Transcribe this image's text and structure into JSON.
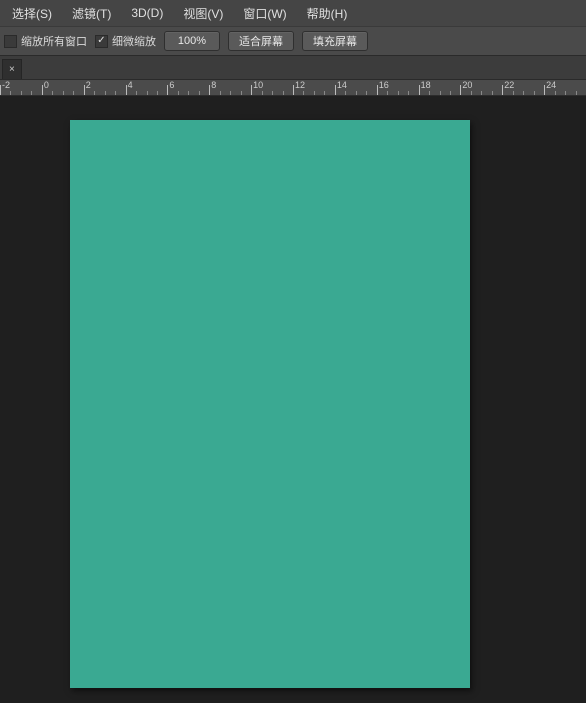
{
  "menubar": {
    "items": [
      {
        "label": "选择(S)"
      },
      {
        "label": "滤镜(T)"
      },
      {
        "label": "3D(D)"
      },
      {
        "label": "视图(V)"
      },
      {
        "label": "窗口(W)"
      },
      {
        "label": "帮助(H)"
      }
    ]
  },
  "options": {
    "zoom_all_label": "缩放所有窗口",
    "zoom_all_checked": false,
    "scrubby_zoom_label": "细微缩放",
    "scrubby_zoom_checked": true,
    "zoom_level": "100%",
    "fit_screen": "适合屏幕",
    "fill_screen": "填充屏幕"
  },
  "tab": {
    "close_glyph": "×"
  },
  "ruler": {
    "start": -2,
    "end": 26,
    "step": 2
  },
  "canvas": {
    "fill": "#3aa992"
  }
}
